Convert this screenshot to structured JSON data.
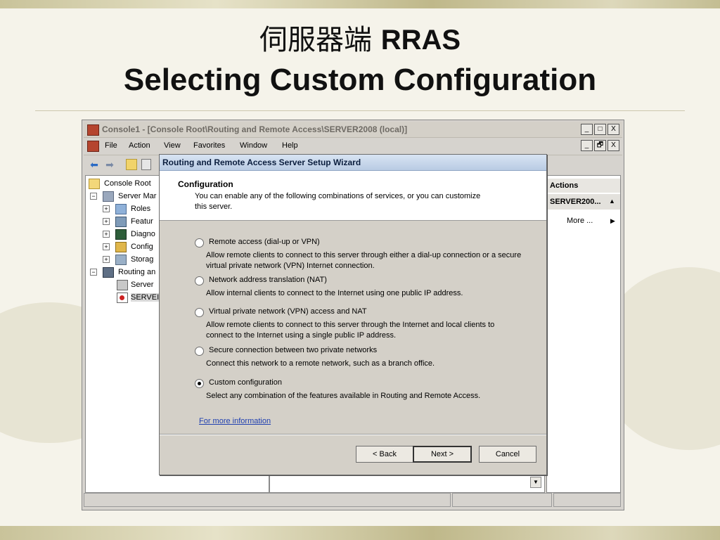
{
  "slide": {
    "title_line1_cjk": "伺服器端",
    "title_line1_latin": "RRAS",
    "title_line2": "Selecting Custom Configuration"
  },
  "mmc": {
    "title": "Console1 - [Console Root\\Routing and Remote Access\\SERVER2008 (local)]",
    "window_buttons": [
      "_",
      "□",
      "X"
    ],
    "child_buttons": [
      "_",
      "🗗",
      "X"
    ],
    "menu": [
      "File",
      "Action",
      "View",
      "Favorites",
      "Window",
      "Help"
    ],
    "tree": [
      {
        "label": "Console Root",
        "level": 0,
        "expander": ""
      },
      {
        "label": "Server Mar",
        "level": 0,
        "expander": "−"
      },
      {
        "label": "Roles",
        "level": 1,
        "expander": "+"
      },
      {
        "label": "Featur",
        "level": 1,
        "expander": "+"
      },
      {
        "label": "Diagno",
        "level": 1,
        "expander": "+"
      },
      {
        "label": "Config",
        "level": 1,
        "expander": "+"
      },
      {
        "label": "Storag",
        "level": 1,
        "expander": "+"
      },
      {
        "label": "Routing an",
        "level": 0,
        "expander": "−"
      },
      {
        "label": "Server",
        "level": 1,
        "expander": ""
      },
      {
        "label": "SERVEI",
        "level": 1,
        "expander": ""
      }
    ],
    "actions": {
      "header": "Actions",
      "section": "SERVER200...",
      "more": "More ..."
    }
  },
  "wizard": {
    "title": "Routing and Remote Access Server Setup Wizard",
    "header": "Configuration",
    "header_desc": "You can enable any of the following combinations of services, or you can customize this server.",
    "options": [
      {
        "label": "Remote access (dial-up or VPN)",
        "desc": "Allow remote clients to connect to this server through either a dial-up connection or a secure virtual private network (VPN) Internet connection.",
        "checked": false
      },
      {
        "label": "Network address translation (NAT)",
        "desc": "Allow internal clients to connect to the Internet using one public IP address.",
        "checked": false
      },
      {
        "label": "Virtual private network (VPN) access and NAT",
        "desc": "Allow remote clients to connect to this server through the Internet and local clients to connect to the Internet using a single public IP address.",
        "checked": false
      },
      {
        "label": "Secure connection between two private networks",
        "desc": "Connect this network to a remote network, such as a branch office.",
        "checked": false
      },
      {
        "label": "Custom configuration",
        "desc": "Select any combination of the features available in Routing and Remote Access.",
        "checked": true
      }
    ],
    "more_info": "For more information",
    "buttons": {
      "back": "< Back",
      "next": "Next >",
      "cancel": "Cancel"
    }
  }
}
